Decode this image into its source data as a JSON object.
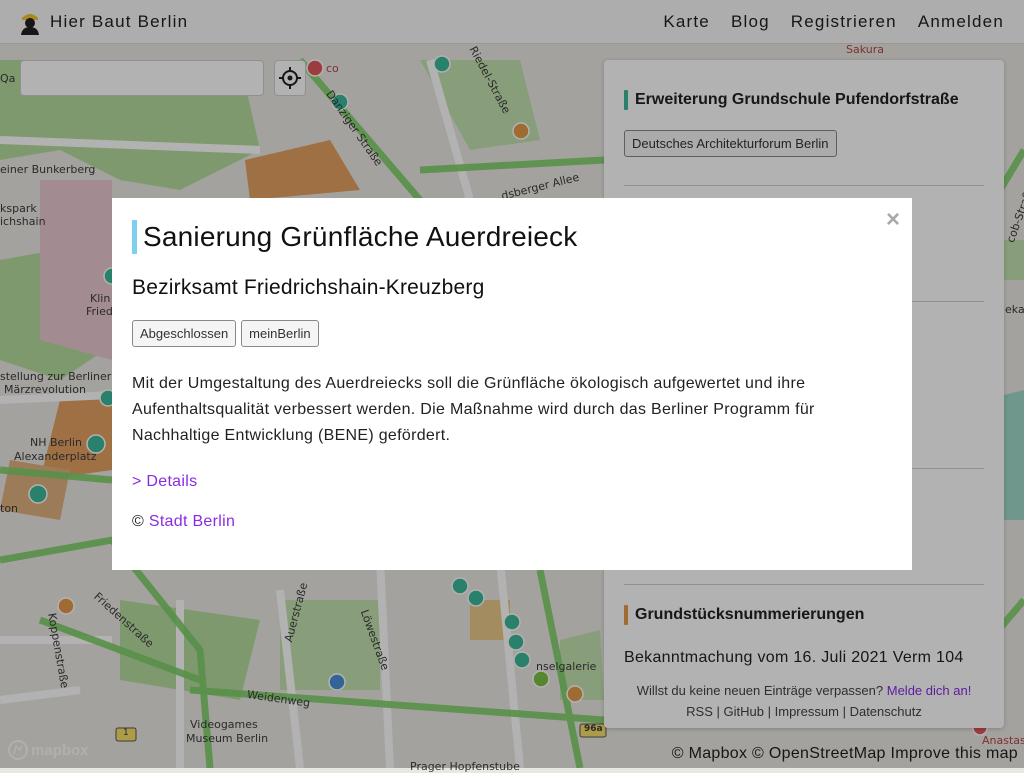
{
  "navbar": {
    "brand": "Hier Baut Berlin",
    "links": [
      "Karte",
      "Blog",
      "Registrieren",
      "Anmelden"
    ]
  },
  "search": {
    "placeholder": ""
  },
  "map_labels": {
    "sakura": "Sakura",
    "riedel": "Riedel-Straße",
    "danziger": "Danziger Straße",
    "landsberger": "dsberger Allee",
    "bunkerberg": "einer Bunkerberg",
    "kspark": "kspark",
    "ichshain": "ichshain",
    "klin": "Klin",
    "fried": "Fried",
    "stellung": "stellung zur Berliner",
    "maerz": "Märzrevolution",
    "nh": "NH Berlin",
    "alexanderplatz": "Alexanderplatz",
    "ton": "ton",
    "friedenstrasse": "Friedenstraße",
    "koppenstrasse": "Koppenstraße",
    "auerstrasse": "Auerstraße",
    "loewestrasse": "Löwestraße",
    "weidenweg": "Weidenweg",
    "videogames": "Videogames",
    "museum": "Museum Berlin",
    "galerie": "nselgalerie",
    "hofen": "Prager Hopfenstube",
    "cobstrasse": "cob-Straße",
    "eka": "eka",
    "anastas": "Anastas",
    "co": "co",
    "qa": "Qa",
    "shield_1": "1",
    "shield_96a": "96a"
  },
  "sidebar": {
    "entry1": {
      "title": "Erweiterung Grundschule Pufendorfstraße",
      "tag": "Deutsches Architekturforum Berlin"
    },
    "entry2": {
      "title": "Grundstücksnummerierungen",
      "text": "Bekanntmachung vom 16. Juli 2021 Verm 104"
    },
    "footer": {
      "prompt": "Willst du keine neuen Einträge verpassen?",
      "signup": "Melde dich an!",
      "links": [
        "RSS",
        "GitHub",
        "Impressum",
        "Datenschutz"
      ],
      "separator": "|"
    }
  },
  "attribution": {
    "mapbox_logo": "mapbox",
    "text": "© Mapbox © OpenStreetMap Improve this map"
  },
  "modal": {
    "close": "×",
    "title": "Sanierung Grünfläche Auerdreieck",
    "subtitle": "Bezirksamt Friedrichshain-Kreuzberg",
    "tags": [
      "Abgeschlossen",
      "meinBerlin"
    ],
    "description": "Mit der Umgestaltung des Auerdreiecks soll die Grünfläche ökologisch aufgewertet und ihre Aufenthaltsqualität verbessert werden. Die Maßnahme wird durch das Berliner Programm für Nachhaltige Entwicklung (BENE) gefördert.",
    "details": "> Details",
    "credit_prefix": "©",
    "credit_link": "Stadt Berlin"
  },
  "colors": {
    "teal_bar": "#3cb89a",
    "orange_bar": "#e49a4a",
    "modal_bar": "#7ecff0",
    "link": "#8a2be2",
    "marker_teal": "#3cb89a",
    "marker_orange": "#e49a4a",
    "marker_red": "#e0575b",
    "marker_blue": "#4a90d9",
    "marker_green": "#7cc242"
  }
}
